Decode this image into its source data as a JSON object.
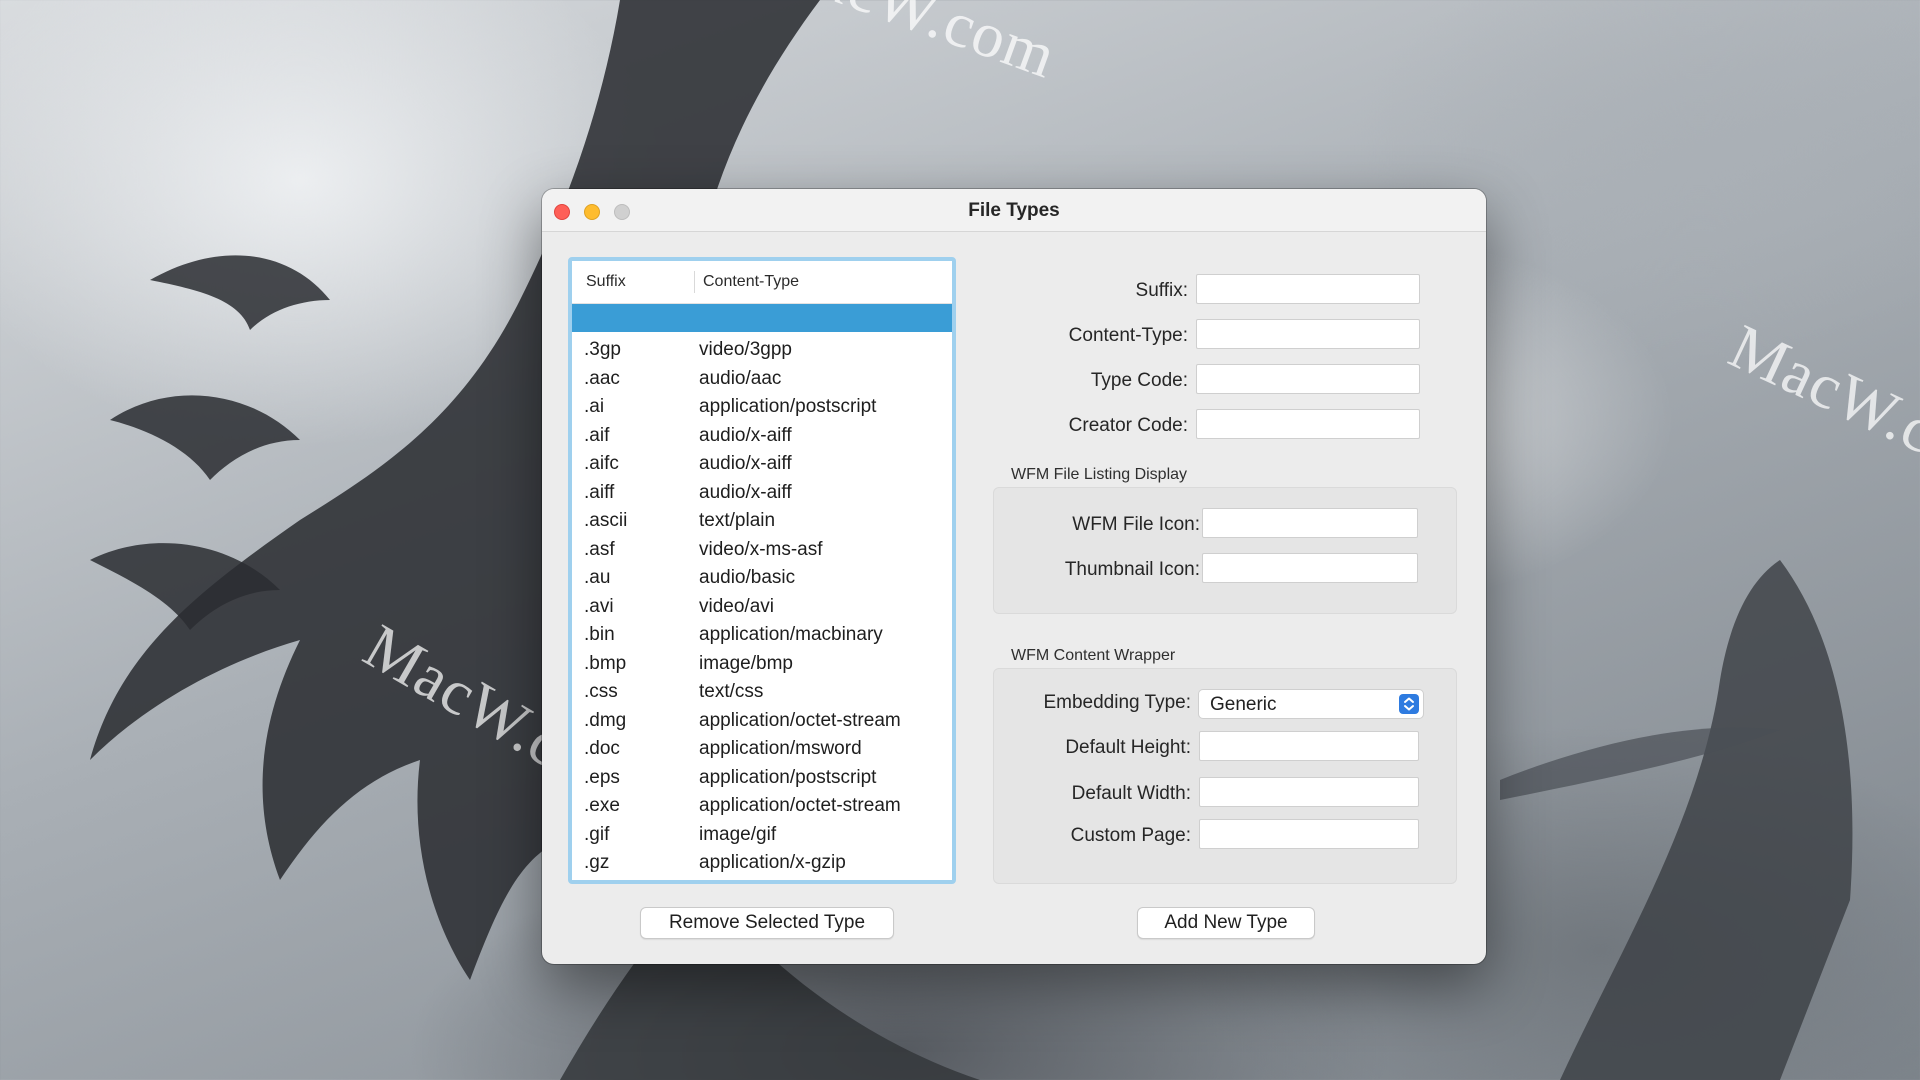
{
  "window": {
    "title": "File Types"
  },
  "watermark": {
    "text": "MacW.com"
  },
  "list": {
    "columns": {
      "suffix": "Suffix",
      "content_type": "Content-Type"
    },
    "selected_row": "blank",
    "rows": [
      {
        "suffix": ".3gp",
        "content_type": "video/3gpp"
      },
      {
        "suffix": ".aac",
        "content_type": "audio/aac"
      },
      {
        "suffix": ".ai",
        "content_type": "application/postscript"
      },
      {
        "suffix": ".aif",
        "content_type": "audio/x-aiff"
      },
      {
        "suffix": ".aifc",
        "content_type": "audio/x-aiff"
      },
      {
        "suffix": ".aiff",
        "content_type": "audio/x-aiff"
      },
      {
        "suffix": ".ascii",
        "content_type": "text/plain"
      },
      {
        "suffix": ".asf",
        "content_type": "video/x-ms-asf"
      },
      {
        "suffix": ".au",
        "content_type": "audio/basic"
      },
      {
        "suffix": ".avi",
        "content_type": "video/avi"
      },
      {
        "suffix": ".bin",
        "content_type": "application/macbinary"
      },
      {
        "suffix": ".bmp",
        "content_type": "image/bmp"
      },
      {
        "suffix": ".css",
        "content_type": "text/css"
      },
      {
        "suffix": ".dmg",
        "content_type": "application/octet-stream"
      },
      {
        "suffix": ".doc",
        "content_type": "application/msword"
      },
      {
        "suffix": ".eps",
        "content_type": "application/postscript"
      },
      {
        "suffix": ".exe",
        "content_type": "application/octet-stream"
      },
      {
        "suffix": ".gif",
        "content_type": "image/gif"
      },
      {
        "suffix": ".gz",
        "content_type": "application/x-gzip"
      }
    ]
  },
  "form": {
    "suffix_label": "Suffix:",
    "content_type_label": "Content-Type:",
    "type_code_label": "Type Code:",
    "creator_code_label": "Creator Code:",
    "suffix_value": "",
    "content_type_value": "",
    "type_code_value": "",
    "creator_code_value": ""
  },
  "listing_display": {
    "title": "WFM File Listing Display",
    "file_icon_label": "WFM File Icon:",
    "thumbnail_icon_label": "Thumbnail Icon:",
    "file_icon_value": "",
    "thumbnail_icon_value": ""
  },
  "content_wrapper": {
    "title": "WFM Content Wrapper",
    "embedding_type_label": "Embedding Type:",
    "embedding_type_value": "Generic",
    "default_height_label": "Default Height:",
    "default_width_label": "Default Width:",
    "custom_page_label": "Custom Page:",
    "default_height_value": "",
    "default_width_value": "",
    "custom_page_value": ""
  },
  "buttons": {
    "remove": "Remove Selected Type",
    "add": "Add New Type"
  },
  "colors": {
    "selection": "#3a9dd6",
    "focus_ring": "#9fd0ee",
    "close": "#fe5f57",
    "minimize": "#febc2e",
    "zoom_inactive": "#d0d0d0",
    "popup_accent": "#2e7be0"
  }
}
